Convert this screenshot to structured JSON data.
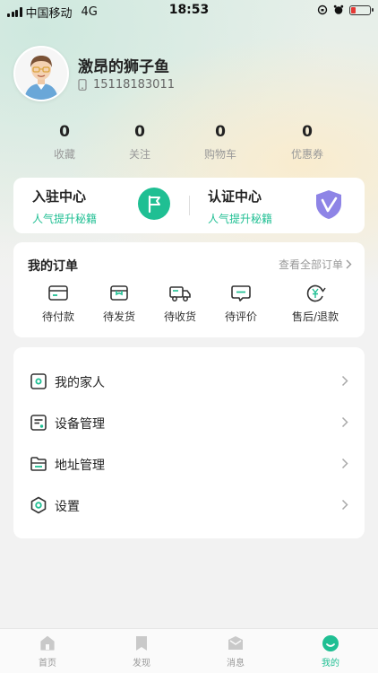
{
  "status_bar": {
    "carrier": "中国移动",
    "network": "4G",
    "time": "18:53"
  },
  "profile": {
    "name": "激昂的狮子鱼",
    "phone": "15118183011"
  },
  "stats": [
    {
      "value": "0",
      "label": "收藏"
    },
    {
      "value": "0",
      "label": "关注"
    },
    {
      "value": "0",
      "label": "购物车"
    },
    {
      "value": "0",
      "label": "优惠券"
    }
  ],
  "cert": {
    "join": {
      "title": "入驻中心",
      "subtitle": "人气提升秘籍"
    },
    "verify": {
      "title": "认证中心",
      "subtitle": "人气提升秘籍"
    }
  },
  "orders": {
    "title": "我的订单",
    "view_all": "查看全部订单",
    "items": [
      {
        "label": "待付款",
        "icon": "card-icon"
      },
      {
        "label": "待发货",
        "icon": "box-icon"
      },
      {
        "label": "待收货",
        "icon": "truck-icon"
      },
      {
        "label": "待评价",
        "icon": "comment-icon"
      },
      {
        "label": "售后/退款",
        "icon": "refund-icon"
      }
    ]
  },
  "menu": [
    {
      "label": "我的家人",
      "icon": "family-icon"
    },
    {
      "label": "设备管理",
      "icon": "device-icon"
    },
    {
      "label": "地址管理",
      "icon": "folder-icon"
    },
    {
      "label": "设置",
      "icon": "settings-icon"
    }
  ],
  "tabbar": [
    {
      "label": "首页",
      "icon": "home-icon"
    },
    {
      "label": "发现",
      "icon": "bookmark-icon"
    },
    {
      "label": "消息",
      "icon": "message-icon"
    },
    {
      "label": "我的",
      "icon": "profile-icon"
    }
  ],
  "colors": {
    "accent": "#1fbf93",
    "shield": "#8e84e6",
    "battery_low": "#e53935"
  }
}
